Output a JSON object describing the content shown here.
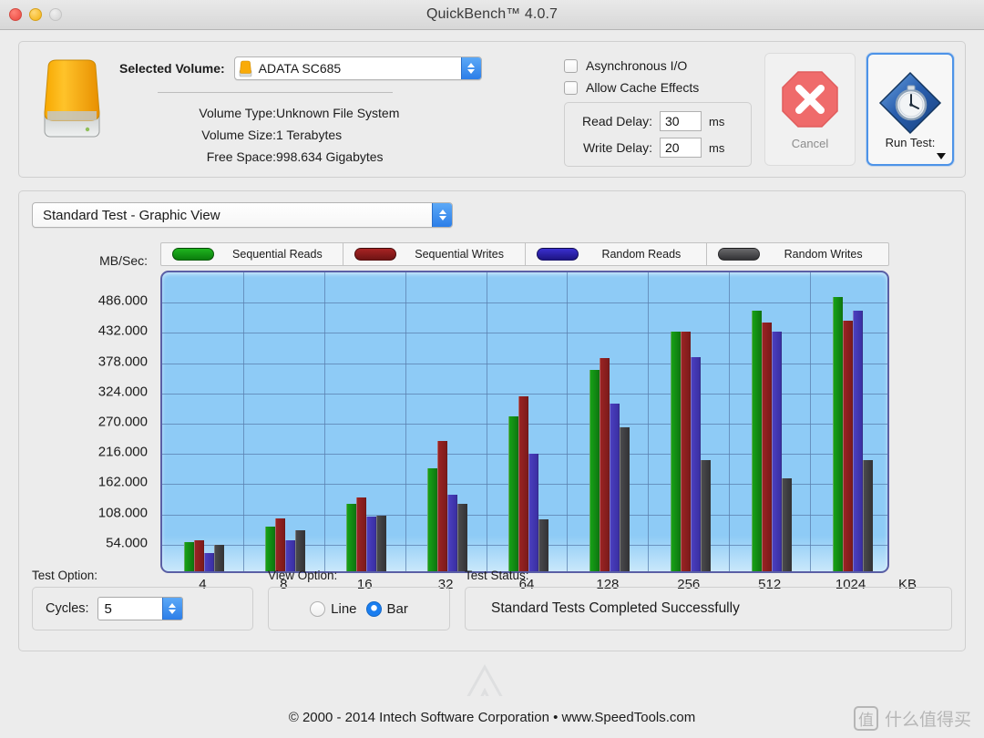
{
  "window": {
    "title": "QuickBench™ 4.0.7",
    "traffic_lights": [
      "close-button",
      "minimize-button",
      "zoom-button"
    ]
  },
  "volume_panel": {
    "drive_icon": "external-hard-drive-icon",
    "selected_volume_label": "Selected Volume:",
    "selected_volume_value": "ADATA SC685",
    "rows": [
      {
        "key": "Volume Type:",
        "value": "Unknown File System"
      },
      {
        "key": "Volume Size:",
        "value": "1 Terabytes"
      },
      {
        "key": "Free Space:",
        "value": "998.634 Gigabytes"
      }
    ]
  },
  "options_panel": {
    "checkboxes": [
      {
        "label": "Asynchronous I/O",
        "checked": false
      },
      {
        "label": "Allow Cache Effects",
        "checked": false
      }
    ],
    "delays": [
      {
        "label": "Read Delay:",
        "value": "30",
        "unit": "ms"
      },
      {
        "label": "Write Delay:",
        "value": "20",
        "unit": "ms"
      }
    ]
  },
  "actions": {
    "cancel_label": "Cancel",
    "cancel_icon": "stop-octagon-icon",
    "cancel_enabled": false,
    "run_label": "Run Test:",
    "run_icon": "stopwatch-diamond-icon",
    "run_has_dropdown": true
  },
  "test_view": {
    "selected_view": "Standard Test - Graphic View"
  },
  "bottom": {
    "test_option_caption": "Test Option:",
    "cycles_label": "Cycles:",
    "cycles_value": "5",
    "view_option_caption": "View Option:",
    "view_options": [
      {
        "label": "Line",
        "selected": false
      },
      {
        "label": "Bar",
        "selected": true
      }
    ],
    "test_status_caption": "Test Status:",
    "test_status_value": "Standard Tests Completed Successfully"
  },
  "footer": {
    "copyright": "© 2000 - 2014 Intech Software Corporation • www.SpeedTools.com"
  },
  "watermark": {
    "badge": "值",
    "text": "什么值得买"
  },
  "chart_data": {
    "type": "bar",
    "title": "",
    "xlabel": "KB",
    "ylabel": "MB/Sec:",
    "categories": [
      "4",
      "8",
      "16",
      "32",
      "64",
      "128",
      "256",
      "512",
      "1024"
    ],
    "x_unit": "KB",
    "ylim": [
      0,
      540
    ],
    "yticks": [
      "54.000",
      "108.000",
      "162.000",
      "216.000",
      "270.000",
      "324.000",
      "378.000",
      "432.000",
      "486.000"
    ],
    "ytick_values": [
      54,
      108,
      162,
      216,
      270,
      324,
      378,
      432,
      486
    ],
    "grid": true,
    "legend_position": "top",
    "series": [
      {
        "name": "Sequential Reads",
        "color": "#0e8a10",
        "values": [
          52,
          79,
          121,
          184,
          276,
          359,
          428,
          465,
          490
        ]
      },
      {
        "name": "Sequential Writes",
        "color": "#8e2020",
        "values": [
          55,
          95,
          132,
          233,
          312,
          380,
          428,
          444,
          448
        ]
      },
      {
        "name": "Random Reads",
        "color": "#3f33ad",
        "values": [
          32,
          55,
          97,
          136,
          210,
          299,
          383,
          428,
          465
        ]
      },
      {
        "name": "Random Writes",
        "color": "#3f3f42",
        "values": [
          48,
          73,
          100,
          121,
          92,
          257,
          199,
          166,
          199
        ]
      }
    ]
  }
}
